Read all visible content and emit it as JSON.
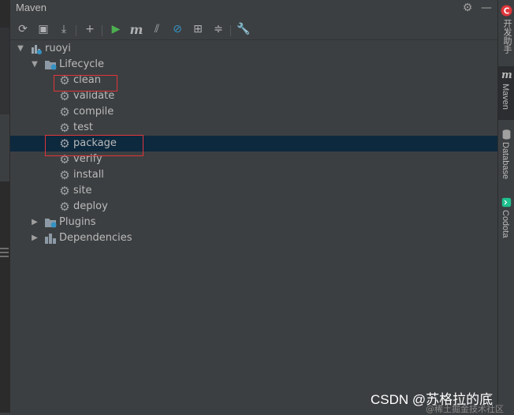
{
  "window": {
    "title": "Maven"
  },
  "titlebar_icons": [
    "gear-icon",
    "minimize-icon"
  ],
  "toolbar": {
    "buttons": [
      {
        "name": "reload-all-projects-button",
        "glyph": "⟳"
      },
      {
        "name": "generate-sources-button",
        "glyph": "▣"
      },
      {
        "name": "download-sources-button",
        "glyph": "⤓"
      },
      {
        "name": "add-maven-project-button",
        "glyph": "+"
      },
      {
        "name": "run-maven-build-button",
        "glyph": "▶"
      },
      {
        "name": "execute-maven-goal-button",
        "glyph": "m"
      },
      {
        "name": "toggle-offline-mode-button",
        "glyph": "⫽"
      },
      {
        "name": "skip-tests-button",
        "glyph": "⊘"
      },
      {
        "name": "show-dependencies-button",
        "glyph": "⊞"
      },
      {
        "name": "collapse-all-button",
        "glyph": "≑"
      },
      {
        "name": "maven-settings-button",
        "glyph": "🔧"
      }
    ]
  },
  "tree": {
    "project": "ruoyi",
    "lifecycle": {
      "label": "Lifecycle",
      "goals": [
        "clean",
        "validate",
        "compile",
        "test",
        "package",
        "verify",
        "install",
        "site",
        "deploy"
      ]
    },
    "plugins": "Plugins",
    "dependencies": "Dependencies"
  },
  "selected_goal": "package",
  "highlighted_goals": [
    "clean",
    "package"
  ],
  "right_tabs": [
    {
      "label": "开发助手",
      "icon": "c-logo-icon",
      "active": false
    },
    {
      "label": "Maven",
      "icon": "maven-icon",
      "active": true
    },
    {
      "label": "Database",
      "icon": "database-icon",
      "active": false
    },
    {
      "label": "Codota",
      "icon": "codota-icon",
      "active": false
    }
  ],
  "watermark": {
    "main": "CSDN @苏格拉的底",
    "sub": "@稀土掘金技术社区"
  },
  "colors": {
    "selection": "#0d293e",
    "highlight_box": "#e0353b",
    "run": "#4caf50"
  }
}
